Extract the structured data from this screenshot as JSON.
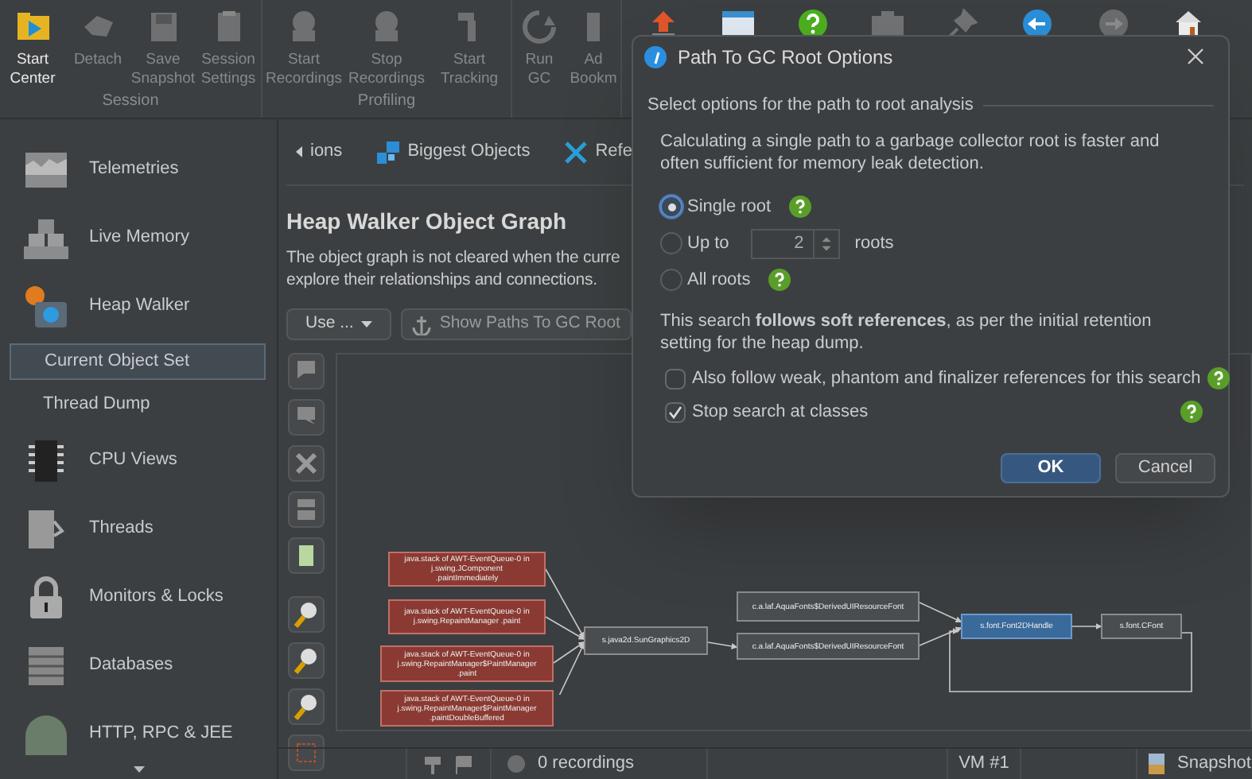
{
  "toolbar": {
    "groups": [
      {
        "label": "Session",
        "buttons": [
          {
            "label": "Start Center",
            "disabled": false
          },
          {
            "label": "Detach",
            "disabled": true
          },
          {
            "label": "Save Snapshot",
            "disabled": true
          },
          {
            "label": "Session Settings",
            "disabled": true
          }
        ]
      },
      {
        "label": "Profiling",
        "buttons": [
          {
            "label": "Start Recordings",
            "disabled": true
          },
          {
            "label": "Stop Recordings",
            "disabled": true
          },
          {
            "label": "Start Tracking",
            "disabled": true
          }
        ]
      },
      {
        "buttons": [
          {
            "label": "Run GC",
            "disabled": true
          },
          {
            "label": "Ad Bookm",
            "disabled": true
          }
        ]
      }
    ]
  },
  "sidebar": {
    "items": [
      {
        "label": "Telemetries",
        "selected": false
      },
      {
        "label": "Live Memory",
        "selected": false
      },
      {
        "label": "Heap Walker",
        "selected": false,
        "children": [
          {
            "label": "Current Object Set",
            "selected": true
          },
          {
            "label": "Thread Dump",
            "selected": false
          }
        ]
      },
      {
        "label": "CPU Views",
        "selected": false
      },
      {
        "label": "Threads",
        "selected": false
      },
      {
        "label": "Monitors & Locks",
        "selected": false
      },
      {
        "label": "Databases",
        "selected": false
      },
      {
        "label": "HTTP, RPC & JEE",
        "selected": false
      }
    ]
  },
  "tabs": [
    {
      "label": "ions"
    },
    {
      "label": "Biggest Objects"
    },
    {
      "label": "Refe"
    }
  ],
  "heading": "Heap Walker Object Graph",
  "description_lines": [
    "The object graph is not cleared when the curre",
    "explore their relationships and connections."
  ],
  "actions": [
    {
      "label": "Use ...",
      "kind": "dropdown"
    },
    {
      "label": "Show Paths To GC Root",
      "kind": "anchor"
    }
  ],
  "graph": {
    "nodes": [
      {
        "kind": "stack",
        "label": "java.stack of AWT-EventQueue-0 in j.swing.JComponent .paintImmediately"
      },
      {
        "kind": "stack",
        "label": "java.stack of AWT-EventQueue-0 in j.swing.RepaintManager .paint"
      },
      {
        "kind": "stack",
        "label": "java.stack of AWT-EventQueue-0 in j.swing.RepaintManager$PaintManager .paint"
      },
      {
        "kind": "stack",
        "label": "java.stack of AWT-EventQueue-0 in j.swing.RepaintManager$PaintManager .paintDoubleBuffered"
      },
      {
        "kind": "object",
        "label": "s.java2d.SunGraphics2D",
        "selected": false
      },
      {
        "kind": "object",
        "label": "c.a.laf.AquaFonts$DerivedUIResourceFont",
        "selected": false
      },
      {
        "kind": "object",
        "label": "c.a.laf.AquaFonts$DerivedUIResourceFont",
        "selected": false
      },
      {
        "kind": "object",
        "label": "s.font.Font2DHandle",
        "selected": true
      },
      {
        "kind": "object",
        "label": "s.font.CFont",
        "selected": false
      }
    ]
  },
  "status_bar": {
    "recordings": "0 recordings",
    "vm": "VM #1",
    "snapshot": "Snapshot"
  },
  "dialog": {
    "title": "Path To GC Root Options",
    "section_label": "Select options for the path to root analysis",
    "description": "Calculating a single path to a garbage collector root is faster and often sufficient for memory leak detection.",
    "radios": [
      {
        "kind": "plain",
        "label": "Single root",
        "selected": true,
        "help": true
      },
      {
        "kind": "spinner",
        "label": "Up to",
        "value": "2",
        "suffix": "roots",
        "selected": false,
        "help": false
      },
      {
        "kind": "plain",
        "label": "All roots",
        "selected": false,
        "help": true
      }
    ],
    "note": "This search **follows soft references**, as per the initial retention setting for the heap dump.",
    "checkboxes": [
      {
        "label": "Also follow weak, phantom and finalizer references for this search",
        "checked": false
      },
      {
        "label": "Stop search at classes",
        "checked": true
      }
    ],
    "buttons": [
      {
        "label": "OK",
        "primary": true
      },
      {
        "label": "Cancel",
        "primary": false
      }
    ]
  }
}
